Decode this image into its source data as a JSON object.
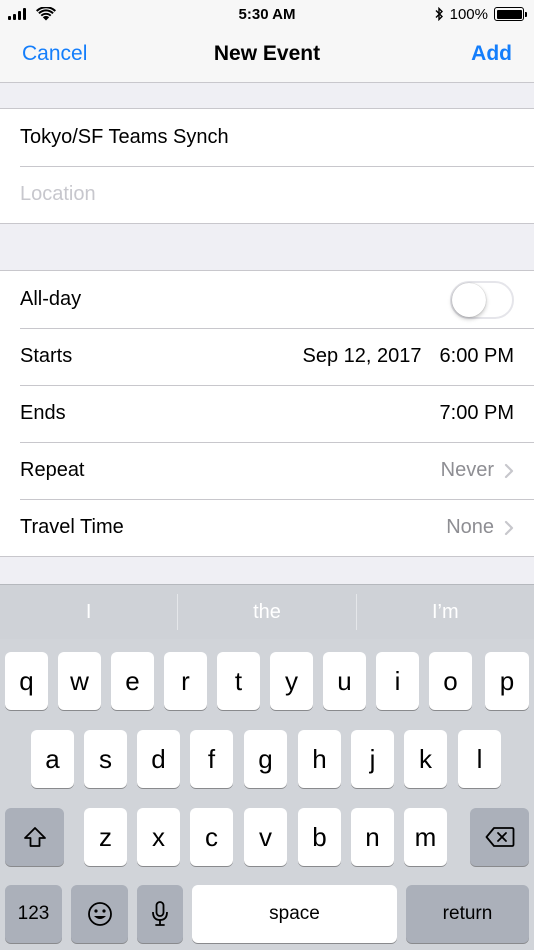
{
  "status_bar": {
    "time": "5:30 AM",
    "battery_percent": "100%",
    "battery_level": 1.0
  },
  "nav": {
    "cancel_label": "Cancel",
    "title": "New Event",
    "add_label": "Add"
  },
  "event": {
    "title_value": "Tokyo/SF Teams Synch",
    "location_placeholder": "Location"
  },
  "details": {
    "all_day_label": "All-day",
    "all_day_on": false,
    "starts_label": "Starts",
    "starts_date": "Sep 12, 2017",
    "starts_time": "6:00 PM",
    "ends_label": "Ends",
    "ends_time": "7:00 PM",
    "repeat_label": "Repeat",
    "repeat_value": "Never",
    "travel_label": "Travel Time",
    "travel_value": "None"
  },
  "keyboard": {
    "suggestions": [
      "I",
      "the",
      "I’m"
    ],
    "row1": [
      "q",
      "w",
      "e",
      "r",
      "t",
      "y",
      "u",
      "i",
      "o",
      "p"
    ],
    "row2": [
      "a",
      "s",
      "d",
      "f",
      "g",
      "h",
      "j",
      "k",
      "l"
    ],
    "row3": [
      "z",
      "x",
      "c",
      "v",
      "b",
      "n",
      "m"
    ],
    "numbers_label": "123",
    "space_label": "space",
    "return_label": "return"
  },
  "colors": {
    "accent": "#147efb",
    "muted_text": "#8e8e93",
    "placeholder": "#c7c7cd",
    "keyboard_bg": "#d1d4d9"
  }
}
